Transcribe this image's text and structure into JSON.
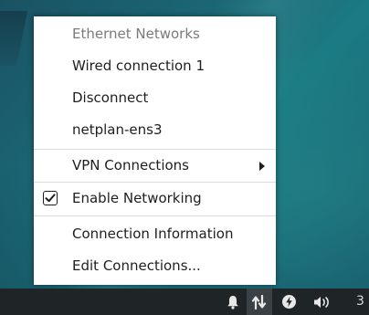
{
  "network_menu": {
    "header": "Ethernet Networks",
    "items": [
      {
        "label": "Wired connection 1"
      },
      {
        "label": "Disconnect"
      },
      {
        "label": "netplan-ens3"
      }
    ],
    "vpn_label": "VPN Connections",
    "enable_networking": {
      "label": "Enable Networking",
      "checked": true
    },
    "connection_info_label": "Connection Information",
    "edit_connections_label": "Edit Connections..."
  },
  "taskbar": {
    "tray_icons": [
      "bell-icon",
      "network-arrows-icon",
      "power-icon",
      "volume-icon"
    ],
    "clock_text": "3"
  },
  "colors": {
    "menu_bg": "#ffffff",
    "taskbar_bg": "#1f2426",
    "desktop_teal": "#1c6f7c"
  }
}
